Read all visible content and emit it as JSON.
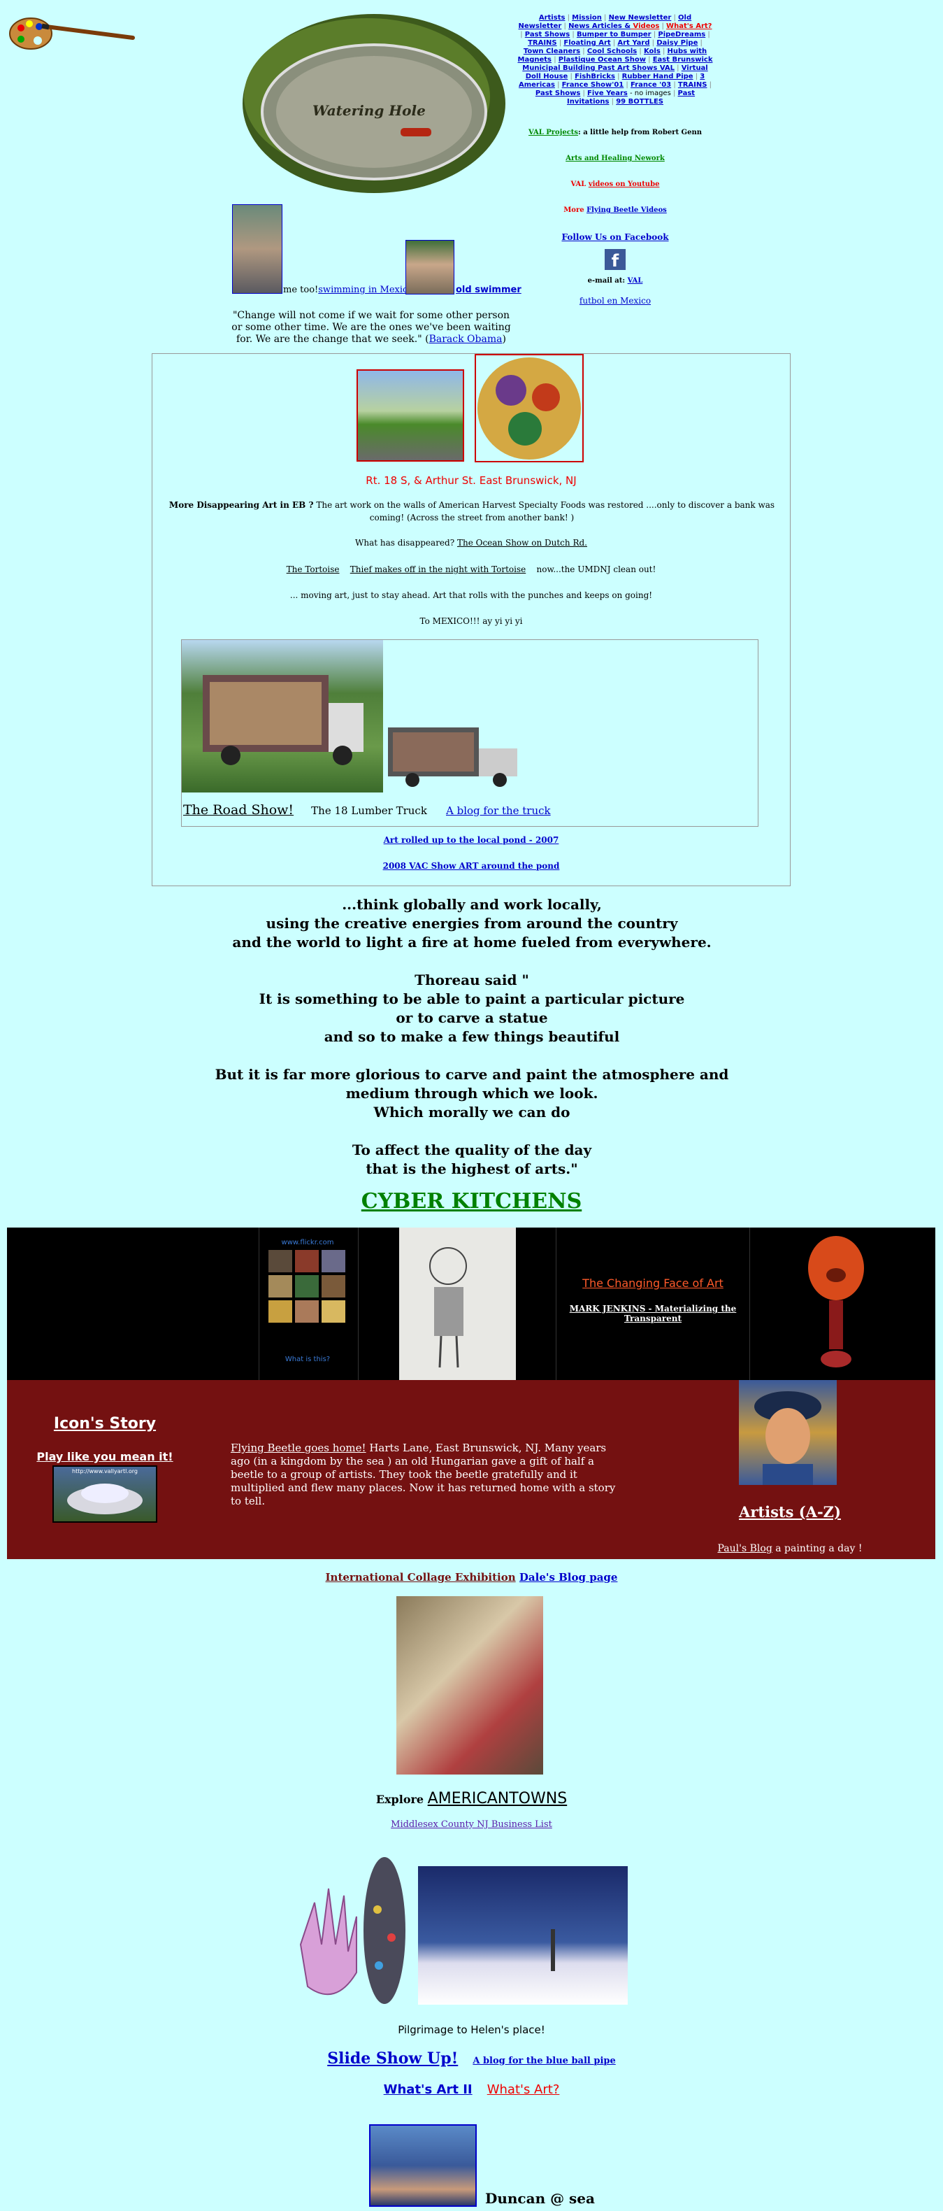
{
  "icons": {
    "palette": "palette-icon",
    "facebook": "facebook-icon"
  },
  "header": {
    "pond_title": "Watering Hole",
    "nav": [
      {
        "t": "Artists"
      },
      {
        "t": "Mission"
      },
      {
        "t": "New Newsletter"
      },
      {
        "t": "Old Newsletter"
      },
      {
        "t": "News Articles &",
        "red_t": "Videos"
      },
      {
        "t": "What's Art?",
        "red": true
      },
      {
        "t": "Past Shows"
      },
      {
        "t": "Bumper to Bumper"
      },
      {
        "t": "PipeDreams"
      },
      {
        "t": "TRAINS"
      },
      {
        "t": "Floating Art"
      },
      {
        "t": "Art Yard"
      },
      {
        "t": "Daisy Pipe"
      },
      {
        "t": "Town Cleaners"
      },
      {
        "t": "Cool Schools"
      },
      {
        "t": "Kols"
      },
      {
        "t": "Hubs with Magnets"
      },
      {
        "t": "Plastique Ocean Show"
      },
      {
        "t": "East Brunswick Municipal Building Past Art Shows VAL"
      },
      {
        "t": "Virtual Doll House"
      },
      {
        "t": "FishBricks"
      },
      {
        "t": "Rubber Hand Pipe"
      },
      {
        "t": "3 Americas"
      },
      {
        "t": "France Show'01"
      },
      {
        "t": "France '03"
      },
      {
        "t": "TRAINS"
      },
      {
        "t": "Past Shows"
      },
      {
        "t": "Five Years"
      },
      {
        "t": "Past Invitations"
      },
      {
        "t": "99 BOTTLES"
      }
    ],
    "nav_note": "no images",
    "val_projects_link": "VAL Projects",
    "val_projects_text": ": a little help from Robert Genn",
    "arts_healing": "Arts and Healing Nework",
    "val_videos_prefix": "VAL ",
    "val_videos_link": "videos on Youtube",
    "more_prefix": "More ",
    "flying_beetle_videos": "Flying Beetle Videos",
    "follow_facebook": "Follow Us on Facebook",
    "email_label": "e-mail at: ",
    "email_link": "VAL",
    "futbol": "futbol en Mexico"
  },
  "swimmers": {
    "me_too": "me too!",
    "swimming_mexico": "swimming in Mexico",
    "old_swimmer": "old swimmer"
  },
  "obama": {
    "quote": "\"Change will not come if we wait for some other person or some other time. We are the ones we've been waiting for. We are the change that we seek.\"",
    "attribution": "Barack Obama"
  },
  "eb_box": {
    "location": "Rt. 18 S, & Arthur St. East Brunswick, NJ",
    "disappearing_bold": "More Disappearing Art in EB ?",
    "disappearing_text": " The art work on the walls of American Harvest Specialty Foods was restored ....only to discover a bank was coming! (Across the street from another bank! )",
    "what_disappeared": "What has disappeared? ",
    "ocean_show": "The Ocean Show on Dutch Rd.",
    "tortoise": "The Tortoise",
    "thief": "Thief makes off in the night with Tortoise",
    "umdnj": "now...the UMDNJ clean out!",
    "moving_art": "... moving art, just to stay ahead. Art that rolls with the punches and keeps on going!",
    "to_mexico": "To MEXICO!!! ay yi yi yi",
    "road_show": "The Road Show!",
    "lumber_truck": "The 18 Lumber Truck",
    "truck_blog": "A blog for the truck",
    "art_rolled": "Art rolled up to the local pond - 2007",
    "vac_show": "2008 VAC Show ART around the pond"
  },
  "big_quote": {
    "lines1": [
      "...think globally and work locally,",
      "using the creative energies from around the country",
      "and the world to light a fire at home fueled from everywhere."
    ],
    "lines2": [
      "Thoreau said \"",
      "It is something to be able to paint a particular picture",
      "or to carve a statue",
      "and so to make a few things beautiful"
    ],
    "lines3": [
      "But it is far more glorious to carve and paint the atmosphere and",
      "medium through which we look.",
      "Which morally we can do"
    ],
    "lines4": [
      "To affect the quality of the day",
      "that is the highest of arts.\""
    ]
  },
  "cyber_kitchens": "CYBER KITCHENS",
  "black_band": {
    "flickr_url": "www.flickr.com",
    "flickr_caption": "What is this?",
    "changing_face": "The Changing Face of Art",
    "mark_jenkins": "MARK JENKINS - Materializing the Transparent"
  },
  "red_band": {
    "icons_story": "Icon's Story",
    "play_like": "Play like you mean it!",
    "car_url": "http://www.vallyartl.org",
    "flying_beetle_link": "Flying Beetle goes home!",
    "flying_beetle_text": " Harts Lane, East Brunswick, NJ. Many years ago (in a kingdom by the sea ) an old Hungarian gave a gift of half a beetle to a group of artists. They took the beetle gratefully and it multiplied and flew many places. Now it has returned home with a story to tell.",
    "artists_az": "Artists (A-Z)",
    "pauls_blog": "Paul's Blog",
    "painting_a_day": " a painting a day !"
  },
  "lower": {
    "intl_collage": "International Collage Exhibition",
    "dales_blog": "Dale's Blog page",
    "explore": "Explore ",
    "americantowns": "AMERICANTOWNS",
    "middlesex": "Middlesex County NJ Business List",
    "pilgrimage": "Pilgrimage to Helen's place!",
    "slide_show": "Slide Show Up!",
    "blue_ball_pipe": "A blog for the blue ball pipe",
    "whats_art_2": "What's Art II",
    "whats_art": "What's Art?",
    "duncan": "Duncan @ sea"
  },
  "colors": {
    "background": "#ccffff",
    "black_band": "#000000",
    "red_band": "#741111",
    "cyber_green": "#008000",
    "accent_red": "#ee0000"
  }
}
